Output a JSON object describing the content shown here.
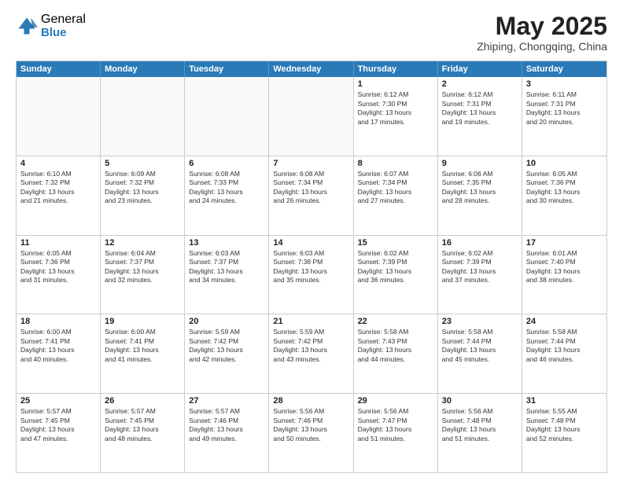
{
  "logo": {
    "general": "General",
    "blue": "Blue"
  },
  "title": "May 2025",
  "subtitle": "Zhiping, Chongqing, China",
  "header_days": [
    "Sunday",
    "Monday",
    "Tuesday",
    "Wednesday",
    "Thursday",
    "Friday",
    "Saturday"
  ],
  "weeks": [
    [
      {
        "day": "",
        "info": "",
        "shade": true
      },
      {
        "day": "",
        "info": "",
        "shade": true
      },
      {
        "day": "",
        "info": "",
        "shade": true
      },
      {
        "day": "",
        "info": "",
        "shade": true
      },
      {
        "day": "1",
        "info": "Sunrise: 6:12 AM\nSunset: 7:30 PM\nDaylight: 13 hours\nand 17 minutes.",
        "shade": false
      },
      {
        "day": "2",
        "info": "Sunrise: 6:12 AM\nSunset: 7:31 PM\nDaylight: 13 hours\nand 19 minutes.",
        "shade": false
      },
      {
        "day": "3",
        "info": "Sunrise: 6:11 AM\nSunset: 7:31 PM\nDaylight: 13 hours\nand 20 minutes.",
        "shade": false
      }
    ],
    [
      {
        "day": "4",
        "info": "Sunrise: 6:10 AM\nSunset: 7:32 PM\nDaylight: 13 hours\nand 21 minutes.",
        "shade": false
      },
      {
        "day": "5",
        "info": "Sunrise: 6:09 AM\nSunset: 7:32 PM\nDaylight: 13 hours\nand 23 minutes.",
        "shade": false
      },
      {
        "day": "6",
        "info": "Sunrise: 6:08 AM\nSunset: 7:33 PM\nDaylight: 13 hours\nand 24 minutes.",
        "shade": false
      },
      {
        "day": "7",
        "info": "Sunrise: 6:08 AM\nSunset: 7:34 PM\nDaylight: 13 hours\nand 26 minutes.",
        "shade": false
      },
      {
        "day": "8",
        "info": "Sunrise: 6:07 AM\nSunset: 7:34 PM\nDaylight: 13 hours\nand 27 minutes.",
        "shade": false
      },
      {
        "day": "9",
        "info": "Sunrise: 6:06 AM\nSunset: 7:35 PM\nDaylight: 13 hours\nand 28 minutes.",
        "shade": false
      },
      {
        "day": "10",
        "info": "Sunrise: 6:05 AM\nSunset: 7:36 PM\nDaylight: 13 hours\nand 30 minutes.",
        "shade": false
      }
    ],
    [
      {
        "day": "11",
        "info": "Sunrise: 6:05 AM\nSunset: 7:36 PM\nDaylight: 13 hours\nand 31 minutes.",
        "shade": false
      },
      {
        "day": "12",
        "info": "Sunrise: 6:04 AM\nSunset: 7:37 PM\nDaylight: 13 hours\nand 32 minutes.",
        "shade": false
      },
      {
        "day": "13",
        "info": "Sunrise: 6:03 AM\nSunset: 7:37 PM\nDaylight: 13 hours\nand 34 minutes.",
        "shade": false
      },
      {
        "day": "14",
        "info": "Sunrise: 6:03 AM\nSunset: 7:38 PM\nDaylight: 13 hours\nand 35 minutes.",
        "shade": false
      },
      {
        "day": "15",
        "info": "Sunrise: 6:02 AM\nSunset: 7:39 PM\nDaylight: 13 hours\nand 36 minutes.",
        "shade": false
      },
      {
        "day": "16",
        "info": "Sunrise: 6:02 AM\nSunset: 7:39 PM\nDaylight: 13 hours\nand 37 minutes.",
        "shade": false
      },
      {
        "day": "17",
        "info": "Sunrise: 6:01 AM\nSunset: 7:40 PM\nDaylight: 13 hours\nand 38 minutes.",
        "shade": false
      }
    ],
    [
      {
        "day": "18",
        "info": "Sunrise: 6:00 AM\nSunset: 7:41 PM\nDaylight: 13 hours\nand 40 minutes.",
        "shade": false
      },
      {
        "day": "19",
        "info": "Sunrise: 6:00 AM\nSunset: 7:41 PM\nDaylight: 13 hours\nand 41 minutes.",
        "shade": false
      },
      {
        "day": "20",
        "info": "Sunrise: 5:59 AM\nSunset: 7:42 PM\nDaylight: 13 hours\nand 42 minutes.",
        "shade": false
      },
      {
        "day": "21",
        "info": "Sunrise: 5:59 AM\nSunset: 7:42 PM\nDaylight: 13 hours\nand 43 minutes.",
        "shade": false
      },
      {
        "day": "22",
        "info": "Sunrise: 5:58 AM\nSunset: 7:43 PM\nDaylight: 13 hours\nand 44 minutes.",
        "shade": false
      },
      {
        "day": "23",
        "info": "Sunrise: 5:58 AM\nSunset: 7:44 PM\nDaylight: 13 hours\nand 45 minutes.",
        "shade": false
      },
      {
        "day": "24",
        "info": "Sunrise: 5:58 AM\nSunset: 7:44 PM\nDaylight: 13 hours\nand 46 minutes.",
        "shade": false
      }
    ],
    [
      {
        "day": "25",
        "info": "Sunrise: 5:57 AM\nSunset: 7:45 PM\nDaylight: 13 hours\nand 47 minutes.",
        "shade": false
      },
      {
        "day": "26",
        "info": "Sunrise: 5:57 AM\nSunset: 7:45 PM\nDaylight: 13 hours\nand 48 minutes.",
        "shade": false
      },
      {
        "day": "27",
        "info": "Sunrise: 5:57 AM\nSunset: 7:46 PM\nDaylight: 13 hours\nand 49 minutes.",
        "shade": false
      },
      {
        "day": "28",
        "info": "Sunrise: 5:56 AM\nSunset: 7:46 PM\nDaylight: 13 hours\nand 50 minutes.",
        "shade": false
      },
      {
        "day": "29",
        "info": "Sunrise: 5:56 AM\nSunset: 7:47 PM\nDaylight: 13 hours\nand 51 minutes.",
        "shade": false
      },
      {
        "day": "30",
        "info": "Sunrise: 5:56 AM\nSunset: 7:48 PM\nDaylight: 13 hours\nand 51 minutes.",
        "shade": false
      },
      {
        "day": "31",
        "info": "Sunrise: 5:55 AM\nSunset: 7:48 PM\nDaylight: 13 hours\nand 52 minutes.",
        "shade": false
      }
    ]
  ]
}
